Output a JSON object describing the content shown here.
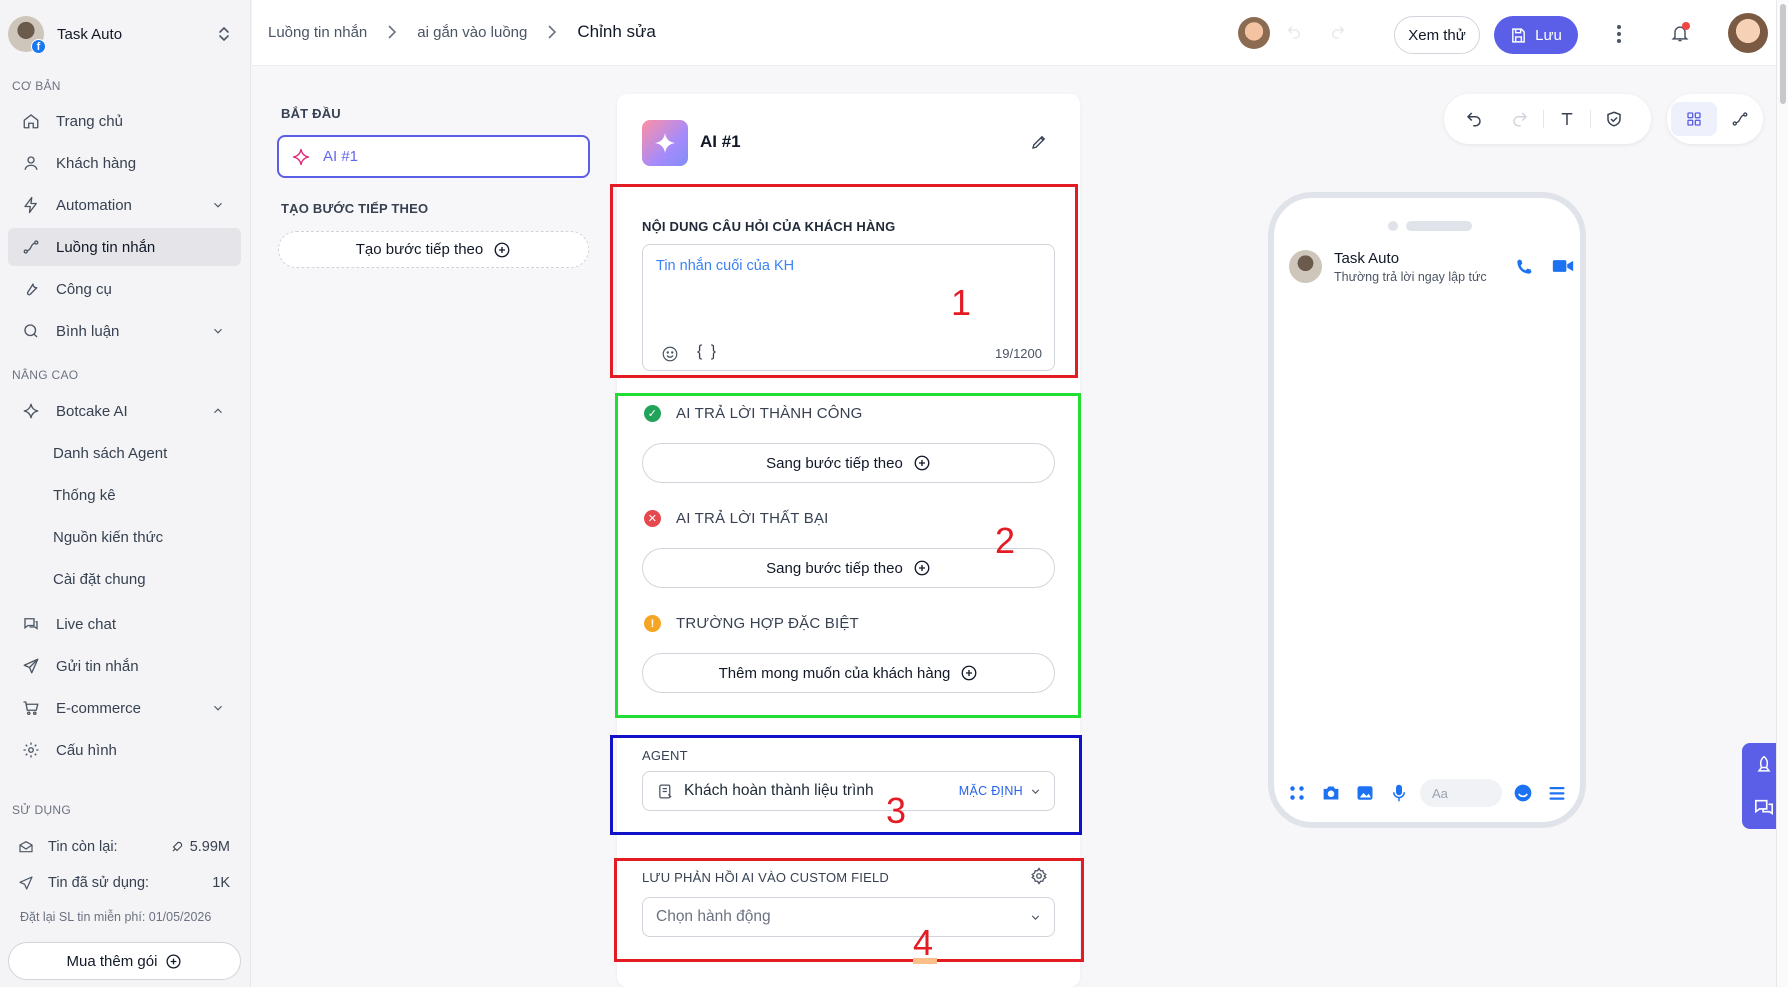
{
  "brand": {
    "name": "Task Auto"
  },
  "sidebar": {
    "sections": {
      "basic": "CƠ BẢN",
      "advanced": "NÂNG CAO",
      "usage": "SỬ DỤNG"
    },
    "items": [
      {
        "label": "Trang chủ",
        "icon": "home-icon"
      },
      {
        "label": "Khách hàng",
        "icon": "user-icon"
      },
      {
        "label": "Automation",
        "icon": "bolt-icon"
      },
      {
        "label": "Luồng tin nhắn",
        "icon": "flow-icon"
      },
      {
        "label": "Công cụ",
        "icon": "wrench-icon"
      },
      {
        "label": "Bình luận",
        "icon": "comment-icon"
      },
      {
        "label": "Botcake AI",
        "icon": "sparkle-icon"
      },
      {
        "label": "Live chat",
        "icon": "chat-icon"
      },
      {
        "label": "Gửi tin nhắn",
        "icon": "send-icon"
      },
      {
        "label": "E-commerce",
        "icon": "cart-icon"
      },
      {
        "label": "Cấu hình",
        "icon": "gear-icon"
      }
    ],
    "botcake_sub": [
      "Danh sách Agent",
      "Thống kê",
      "Nguồn kiến thức",
      "Cài đặt chung"
    ],
    "usage": {
      "remaining_label": "Tin còn lại:",
      "remaining_value": "5.99M",
      "used_label": "Tin đã sử dụng:",
      "used_value": "1K",
      "reset_note": "Đặt lại SL tin miễn phí: 01/05/2026",
      "buy_label": "Mua thêm gói"
    }
  },
  "header": {
    "breadcrumb": [
      "Luồng tin nhắn",
      "ai gắn vào luồng",
      "Chỉnh sửa"
    ],
    "preview_label": "Xem thử",
    "save_label": "Lưu"
  },
  "steps": {
    "start_label": "BẮT ĐẦU",
    "ai_step": "AI #1",
    "next_label": "TẠO BƯỚC TIẾP THEO",
    "next_button": "Tạo bước tiếp theo"
  },
  "card": {
    "title": "AI #1",
    "question_label": "NỘI DUNG CÂU HỎI CỦA KHÁCH HÀNG",
    "question_value": "Tin nhắn cuối của KH",
    "question_braces": "{ }",
    "char_count": "19/1200",
    "success_label": "AI TRẢ LỜI THÀNH CÔNG",
    "success_button": "Sang bước tiếp theo",
    "fail_label": "AI TRẢ LỜI THẤT BẠI",
    "fail_button": "Sang bước tiếp theo",
    "special_label": "TRƯỜNG HỢP ĐẶC BIỆT",
    "special_button": "Thêm mong muốn của khách hàng",
    "agent_label": "AGENT",
    "agent_value": "Khách hoàn thành liệu trình",
    "agent_badge": "MẶC ĐỊNH",
    "custom_field_label": "LƯU PHẢN HỒI AI VÀO CUSTOM FIELD",
    "custom_field_placeholder": "Chọn hành động"
  },
  "annotations": [
    "1",
    "2",
    "3",
    "4"
  ],
  "phone": {
    "chat_name": "Task Auto",
    "chat_status": "Thường trả lời ngay lập tức",
    "composer_placeholder": "Aa"
  },
  "colors": {
    "accent": "#5b5fe8",
    "annotation_red": "#e31b23",
    "annotation_green": "#22dd33",
    "annotation_blue": "#1111c8",
    "messenger_blue": "#1d72f2"
  }
}
